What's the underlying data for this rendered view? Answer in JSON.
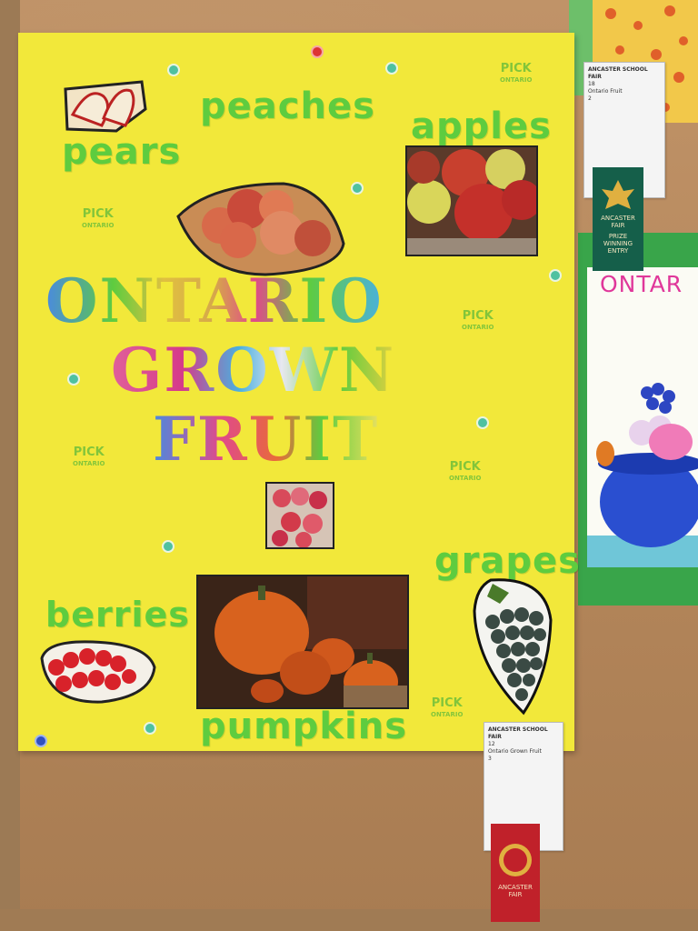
{
  "poster": {
    "title_lines": [
      "ONTARIO",
      "GROWN",
      "FRUIT"
    ],
    "labels": {
      "pears": "pears",
      "peaches": "peaches",
      "apples": "apples",
      "grapes": "grapes",
      "berries": "berries",
      "pumpkins": "pumpkins"
    },
    "watermark": {
      "line1": "PICK",
      "line2": "ONTARIO"
    }
  },
  "side_drawing": {
    "text": "ONTAR"
  },
  "award_tags": {
    "top": {
      "header": "ANCASTER SCHOOL FAIR",
      "class_no": "18",
      "item": "Ontario Fruit",
      "place": "2"
    },
    "bottom": {
      "header": "ANCASTER SCHOOL FAIR",
      "class_no": "12",
      "item": "Ontario Grown Fruit",
      "place": "3"
    }
  },
  "ribbons": {
    "green": {
      "line1": "ANCASTER",
      "line2": "FAIR",
      "line3": "PRIZE",
      "line4": "WINNING",
      "line5": "ENTRY"
    },
    "red": {
      "line1": "ANCASTER",
      "line2": "FAIR"
    }
  },
  "colors": {
    "poster_yellow": "#f2e83a",
    "label_green": "#5ecc3f",
    "cork": "#b88a5e"
  }
}
